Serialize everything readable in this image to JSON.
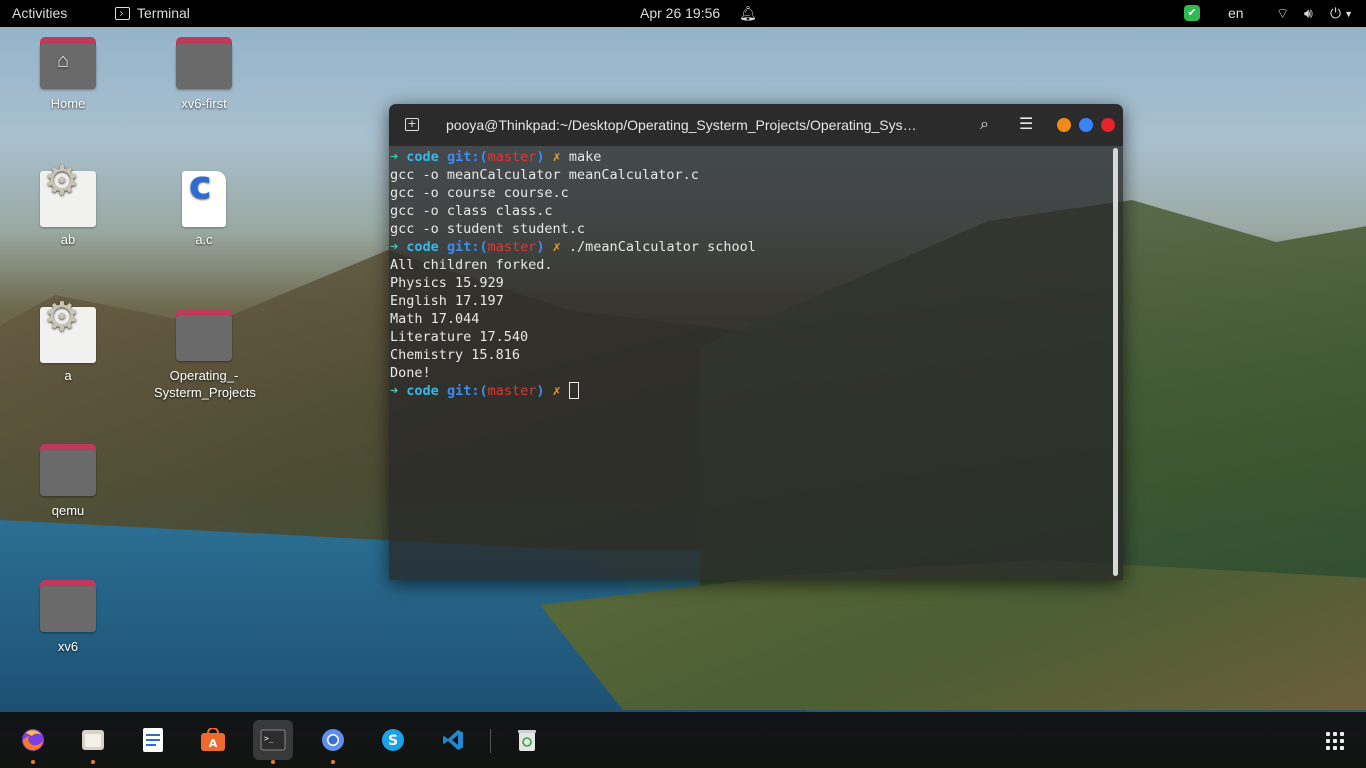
{
  "topbar": {
    "activities": "Activities",
    "app_name": "Terminal",
    "clock": "Apr 26  19:56",
    "language": "en"
  },
  "desktop": {
    "icons": [
      {
        "label": "Home",
        "type": "home-folder"
      },
      {
        "label": "xv6-first",
        "type": "folder"
      },
      {
        "label": "ab",
        "type": "executable"
      },
      {
        "label": "a.c",
        "type": "c-source"
      },
      {
        "label": "a",
        "type": "executable"
      },
      {
        "label": "Operating_-Systerm_Projects",
        "line1": "Operating_-",
        "line2": "Systerm_Projects",
        "type": "folder"
      },
      {
        "label": "qemu",
        "type": "folder"
      },
      {
        "label": "xv6",
        "type": "folder"
      }
    ]
  },
  "terminal": {
    "title": "pooya@Thinkpad:~/Desktop/Operating_Systerm_Projects/Operating_Sys…",
    "prompt": {
      "arrow": "➜",
      "dir": "code",
      "git_prefix": "git:(",
      "branch": "master",
      "git_suffix": ")",
      "dirty": "✗"
    },
    "lines": [
      {
        "prompt": true,
        "command": "make"
      },
      {
        "text": "gcc -o meanCalculator meanCalculator.c"
      },
      {
        "text": "gcc -o course course.c"
      },
      {
        "text": "gcc -o class class.c"
      },
      {
        "text": "gcc -o student student.c"
      },
      {
        "prompt": true,
        "command": "./meanCalculator school"
      },
      {
        "text": "All children forked."
      },
      {
        "text": "Physics 15.929"
      },
      {
        "text": "English 17.197"
      },
      {
        "text": "Math 17.044"
      },
      {
        "text": "Literature 17.540"
      },
      {
        "text": "Chemistry 15.816"
      },
      {
        "text": "Done!"
      },
      {
        "prompt": true,
        "command": ""
      }
    ]
  },
  "dock": {
    "apps": [
      "firefox",
      "files",
      "text-editor",
      "software",
      "terminal",
      "chromium",
      "skype",
      "vscode",
      "trash"
    ]
  },
  "colors": {
    "prompt_arrow": "#2fd0b4",
    "prompt_dir": "#37b9e8",
    "git_label": "#3b8df0",
    "branch": "#e23535",
    "dirty_mark": "#f0a01e",
    "close_button": "#e8232a",
    "minimize_button": "#f28a1a",
    "maximize_button": "#3b82f6"
  }
}
